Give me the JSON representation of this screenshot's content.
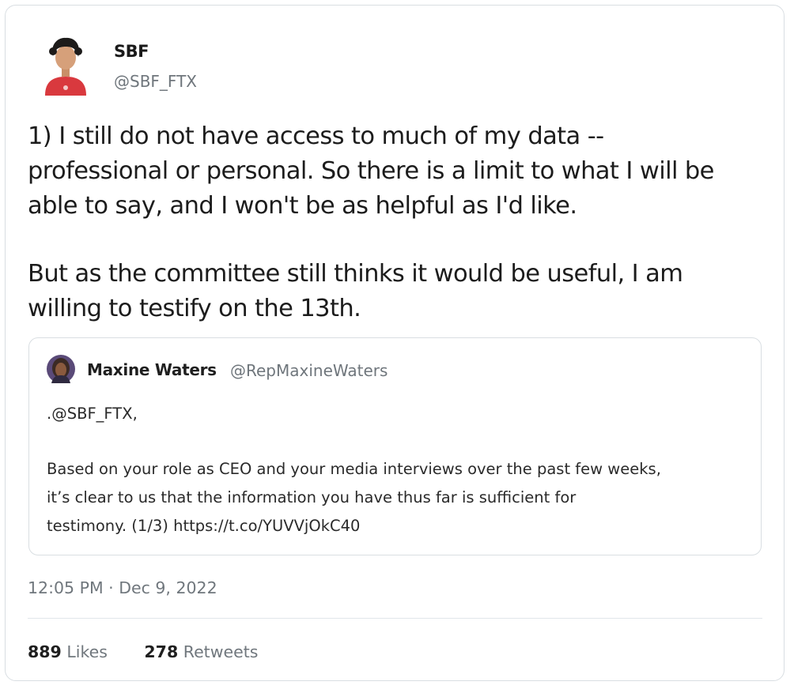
{
  "author": {
    "name": "SBF",
    "handle": "@SBF_FTX"
  },
  "tweet": {
    "paragraph_1": "1) I still do not have access to much of my data --\nprofessional or personal.  So there is a limit to what I will be\nable to say, and I won't be as helpful as I'd like.",
    "paragraph_2": "But as the committee still thinks it would be useful, I am\nwilling to testify on the 13th."
  },
  "quoted_tweet": {
    "name": "Maxine Waters",
    "handle": "@RepMaxineWaters",
    "mention_line": ".@SBF_FTX,",
    "body_lines": [
      "Based on your role as CEO and your media interviews over the past few weeks,",
      "it’s clear to us that the information you have thus far is sufficient for",
      "testimony. (1/3) https://t.co/YUVVjOkC40"
    ]
  },
  "timestamp": "12:05 PM · Dec 9, 2022",
  "stats": {
    "likes_count": "889",
    "likes_label": "Likes",
    "retweets_count": "278",
    "retweets_label": "Retweets"
  },
  "colors": {
    "avatar_shirt": "#d9393e",
    "card_border": "#d9dee2",
    "muted_text": "#70777d"
  }
}
